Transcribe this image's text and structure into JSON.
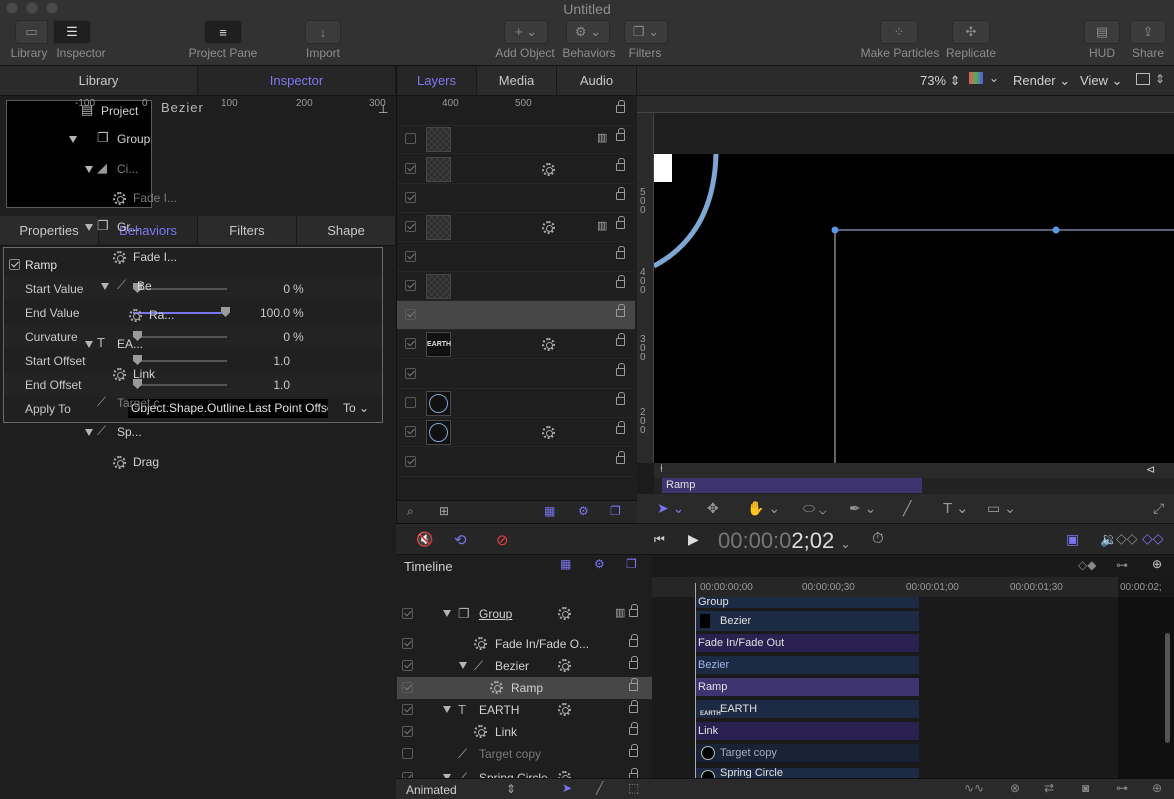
{
  "window": {
    "title": "Untitled"
  },
  "toolbar": {
    "library": "Library",
    "inspector": "Inspector",
    "project_pane": "Project Pane",
    "import": "Import",
    "add_object": "Add Object",
    "behaviors": "Behaviors",
    "filters": "Filters",
    "make_particles": "Make Particles",
    "replicate": "Replicate",
    "hud": "HUD",
    "share": "Share"
  },
  "left_tabs": {
    "library": "Library",
    "inspector": "Inspector"
  },
  "preview": {
    "name": "Bezier"
  },
  "inspector_tabs": {
    "properties": "Properties",
    "behaviors": "Behaviors",
    "filters": "Filters",
    "shape": "Shape"
  },
  "behavior": {
    "name": "Ramp",
    "params": [
      {
        "label": "Start Value",
        "value": "0",
        "unit": "%",
        "level": 0
      },
      {
        "label": "End Value",
        "value": "100.0",
        "unit": "%",
        "level": 1
      },
      {
        "label": "Curvature",
        "value": "0",
        "unit": "%",
        "level": 0
      },
      {
        "label": "Start Offset",
        "value": "1.0",
        "unit": "",
        "level": 0
      },
      {
        "label": "End Offset",
        "value": "1.0",
        "unit": "",
        "level": 0
      }
    ],
    "apply_to_label": "Apply To",
    "apply_to_value": "Object.Shape.Outline.Last Point Offse",
    "apply_to_menu": "To"
  },
  "layers_tabs": {
    "layers": "Layers",
    "media": "Media",
    "audio": "Audio"
  },
  "layers": [
    {
      "name": "Project"
    },
    {
      "name": "Group"
    },
    {
      "name": "Ci..."
    },
    {
      "name": "Fade I..."
    },
    {
      "name": "Gr..."
    },
    {
      "name": "Fade I..."
    },
    {
      "name": "Be"
    },
    {
      "name": "Ra..."
    },
    {
      "name": "EA..."
    },
    {
      "name": "Link"
    },
    {
      "name": "Target c..."
    },
    {
      "name": "Sp..."
    },
    {
      "name": "Drag"
    }
  ],
  "earth_thumb": "EARTH",
  "canvas": {
    "zoom": "73%",
    "render": "Render",
    "view": "View",
    "ruler_ticks": [
      "-100",
      "0",
      "100",
      "200",
      "300",
      "400",
      "500"
    ],
    "vruler_ticks": [
      "500",
      "400",
      "300",
      "200"
    ],
    "mini_bar": "Ramp"
  },
  "transport": {
    "timecode_dim": "00:00:0",
    "timecode": "2;02"
  },
  "timeline": {
    "label": "Timeline",
    "ruler": [
      "00:00:00;00",
      "00:00:00;30",
      "00:00:01;00",
      "00:00:01;30",
      "00:00:02;"
    ],
    "rows": [
      {
        "name": "Group"
      },
      {
        "name": "Fade In/Fade O..."
      },
      {
        "name": "Bezier"
      },
      {
        "name": "Ramp"
      },
      {
        "name": "EARTH"
      },
      {
        "name": "Link"
      },
      {
        "name": "Target copy"
      },
      {
        "name": "Spring Circle"
      }
    ],
    "bars": [
      "Group",
      "Bezier",
      "Fade In/Fade Out",
      "Bezier",
      "Ramp",
      "EARTH",
      "Link",
      "Target copy",
      "Spring Circle"
    ]
  },
  "bottom": {
    "animated": "Animated"
  }
}
